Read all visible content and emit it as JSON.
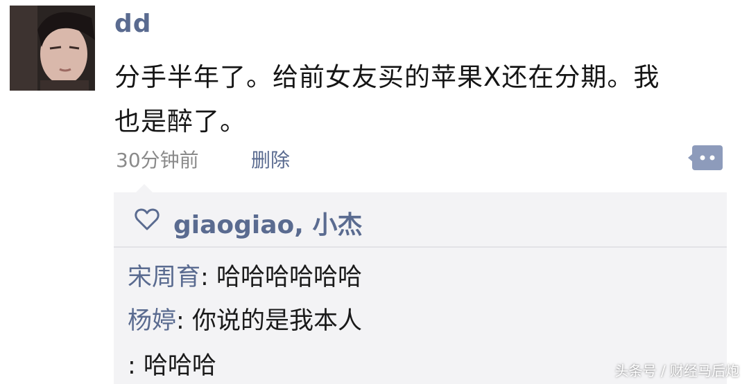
{
  "post": {
    "username": "dd",
    "text": "分手半年了。给前女友买的苹果X还在分期。我也是醉了。",
    "time": "30分钟前",
    "delete_label": "删除"
  },
  "icons": {
    "avatar": "user-avatar-photo",
    "comment": "comment-bubble-icon",
    "like": "heart-outline-icon"
  },
  "likes": {
    "names": "giaogiao, 小杰"
  },
  "comments": [
    {
      "author": "宋周育",
      "separator": ": ",
      "text": "哈哈哈哈哈哈"
    },
    {
      "author": "杨婷",
      "separator": ": ",
      "text": "你说的是我本人"
    },
    {
      "author": "",
      "separator": ": ",
      "text": "哈哈哈"
    }
  ],
  "watermark": "头条号 / 财经马后炮",
  "colors": {
    "link": "#5a6b90",
    "panel_bg": "#f3f3f5",
    "meta_gray": "#8a8a8a"
  }
}
